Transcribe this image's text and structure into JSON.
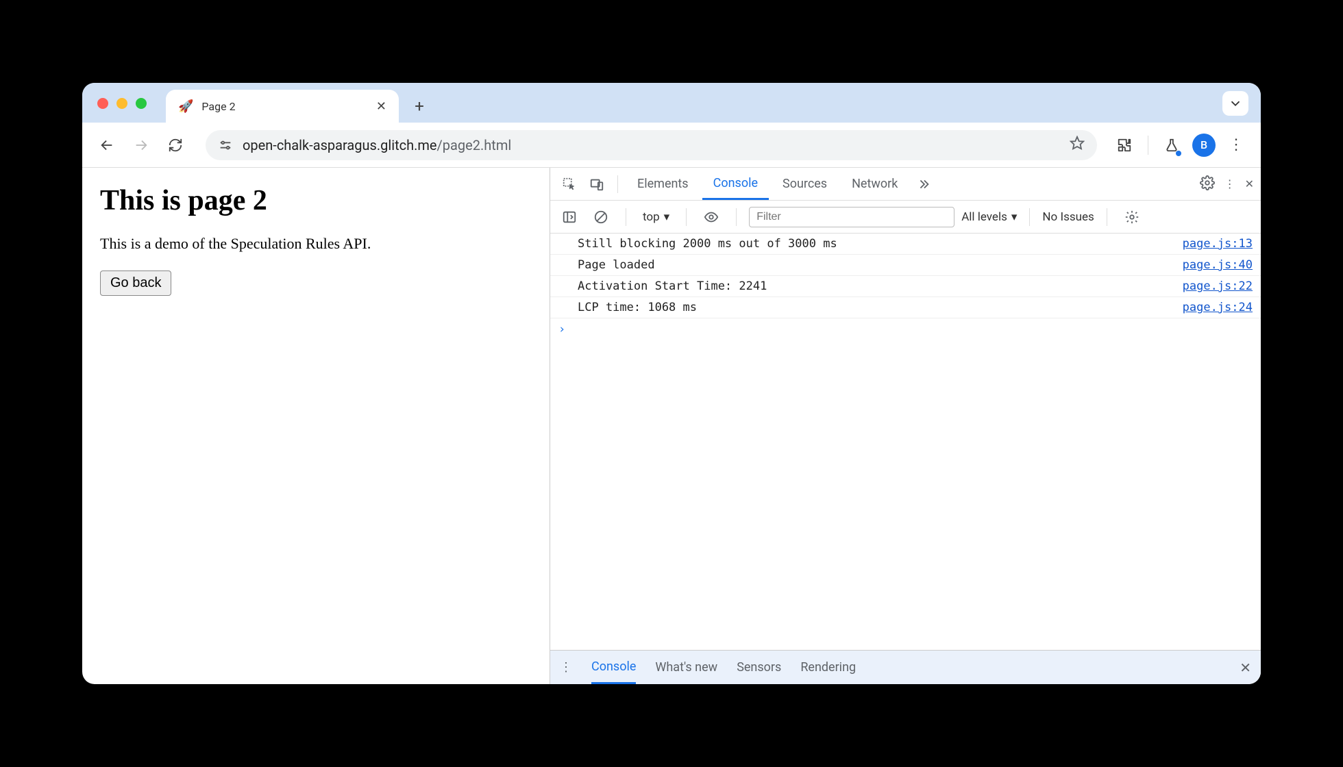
{
  "browser": {
    "tab": {
      "favicon": "🚀",
      "title": "Page 2"
    },
    "url_host": "open-chalk-asparagus.glitch.me",
    "url_path": "/page2.html",
    "avatar_initial": "B"
  },
  "page": {
    "heading": "This is page 2",
    "body": "This is a demo of the Speculation Rules API.",
    "button_label": "Go back"
  },
  "devtools": {
    "tabs": {
      "elements": "Elements",
      "console": "Console",
      "sources": "Sources",
      "network": "Network"
    },
    "filter": {
      "context": "top",
      "placeholder": "Filter",
      "levels": "All levels",
      "issues": "No Issues"
    },
    "logs": [
      {
        "msg": "Still blocking 2000 ms out of 3000 ms",
        "src": "page.js:13"
      },
      {
        "msg": "Page loaded",
        "src": "page.js:40"
      },
      {
        "msg": "Activation Start Time: 2241",
        "src": "page.js:22"
      },
      {
        "msg": "LCP time: 1068 ms",
        "src": "page.js:24"
      }
    ],
    "drawer": {
      "console": "Console",
      "whatsnew": "What's new",
      "sensors": "Sensors",
      "rendering": "Rendering"
    }
  }
}
